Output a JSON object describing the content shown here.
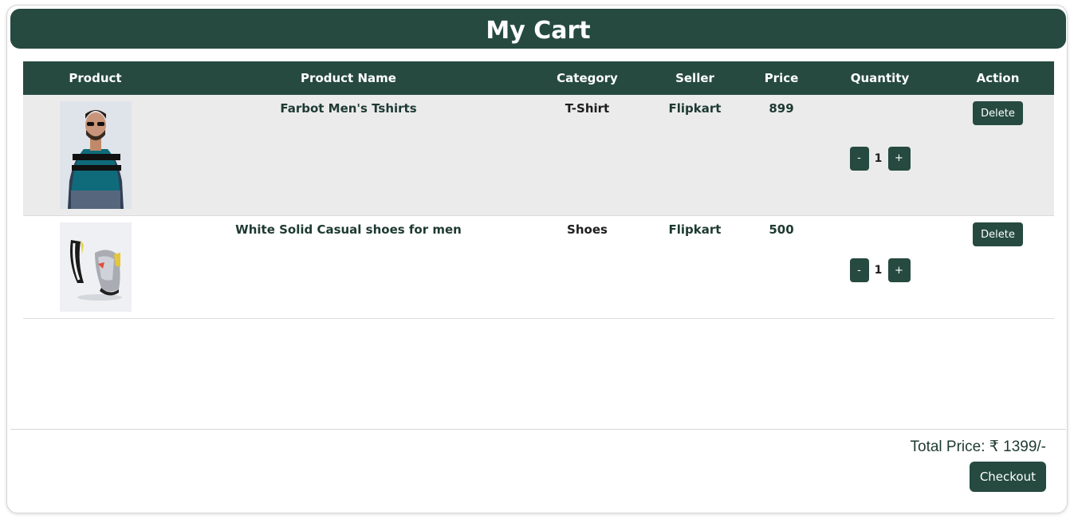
{
  "header": {
    "title": "My Cart"
  },
  "table": {
    "columns": [
      "Product",
      "Product Name",
      "Category",
      "Seller",
      "Price",
      "Quantity",
      "Action"
    ],
    "rows": [
      {
        "name": "Farbot Men's Tshirts",
        "category": "T-Shirt",
        "seller": "Flipkart",
        "price": "899",
        "quantity": "1",
        "image": "man-in-teal-striped-tshirt"
      },
      {
        "name": "White Solid Casual shoes for men",
        "category": "Shoes",
        "seller": "Flipkart",
        "price": "500",
        "quantity": "1",
        "image": "pair-of-sneakers"
      }
    ],
    "minus_label": "-",
    "plus_label": "+",
    "delete_label": "Delete"
  },
  "footer": {
    "total": "Total Price: ₹ 1399/-",
    "checkout_label": "Checkout"
  },
  "colors": {
    "primary": "#264a40",
    "row_alt": "#ebebeb"
  }
}
